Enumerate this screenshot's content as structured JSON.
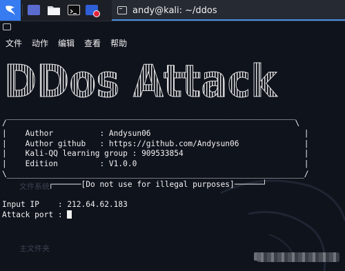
{
  "panel": {
    "icons": [
      "kali-dragon-icon",
      "desktop-icon",
      "folder-icon",
      "terminal-icon",
      "browser-icon"
    ],
    "task_title": "andy@kali: ~/ddos",
    "accent": "#367bf0"
  },
  "menubar": {
    "items": [
      "文件",
      "动作",
      "编辑",
      "查看",
      "帮助"
    ]
  },
  "banner": {
    "title": "DDos Attack"
  },
  "info_box": {
    "top_border": "/‾‾‾‾‾‾‾‾‾‾‾‾‾‾‾‾‾‾‾‾‾‾‾‾‾‾‾‾‾‾‾‾‾‾‾‾‾‾‾‾‾‾‾‾‾‾‾‾‾‾‾‾‾‾‾‾‾‾‾‾‾‾\\",
    "lines": [
      "|    Author          : Andysun06                                 |",
      "|    Author github   : https://github.com/Andysun06              |",
      "|    Kali-QQ learning group : 909533854                          |",
      "|    Edition         : V1.0.0                                    |"
    ],
    "bottom_border": "\\________________________________________________________________/",
    "warning": "          ┌──────[Do not use for illegal purposes]──────┘"
  },
  "prompt": {
    "ip_label": "Input IP",
    "ip_value": "212.64.62.183",
    "port_label": "Attack port"
  },
  "background": {
    "ghost_labels": [
      "文件系统",
      "主文件夹"
    ]
  }
}
